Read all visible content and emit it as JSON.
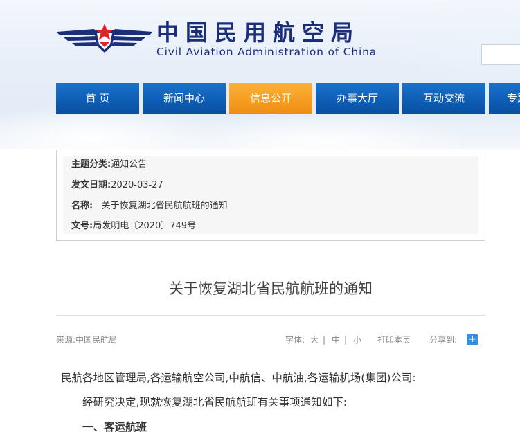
{
  "header": {
    "logo_cn": "中国民用航空局",
    "logo_en": "Civil Aviation Administration of China",
    "emblem_icon": "caac-wings-star-emblem",
    "search_placeholder": ""
  },
  "nav": {
    "items": [
      {
        "label": "首 页",
        "active": false
      },
      {
        "label": "新闻中心",
        "active": false
      },
      {
        "label": "信息公开",
        "active": true
      },
      {
        "label": "办事大厅",
        "active": false
      },
      {
        "label": "互动交流",
        "active": false
      },
      {
        "label": "专题专栏",
        "active": false
      }
    ]
  },
  "meta": {
    "category_key": "主题分类:",
    "category_val": "通知公告",
    "date_key": "发文日期:",
    "date_val": "2020-03-27",
    "name_key": "名称:",
    "name_val": "关于恢复湖北省民航航班的通知",
    "docno_key": "文号:",
    "docno_val": "局发明电〔2020〕749号"
  },
  "article": {
    "title": "关于恢复湖北省民航航班的通知",
    "source": "来源:中国民航局",
    "font_label": "字体:",
    "size_large": "大",
    "size_medium": "中",
    "size_small": "小",
    "separator": "|",
    "print_label": "打印本页",
    "share_label": "分享到:",
    "share_icon_glyph": "+",
    "paragraphs": [
      "民航各地区管理局,各运输航空公司,中航信、中航油,各运输机场(集团)公司:",
      "经研究决定,现就恢复湖北省民航航班有关事项通知如下:",
      "一、客运航班"
    ]
  },
  "colors": {
    "nav_blue": "#0e5db5",
    "nav_active_orange": "#f59b20",
    "logo_navy": "#1a2e7a",
    "font_active": "#f08c0a",
    "share_blue": "#3c8ddf"
  }
}
